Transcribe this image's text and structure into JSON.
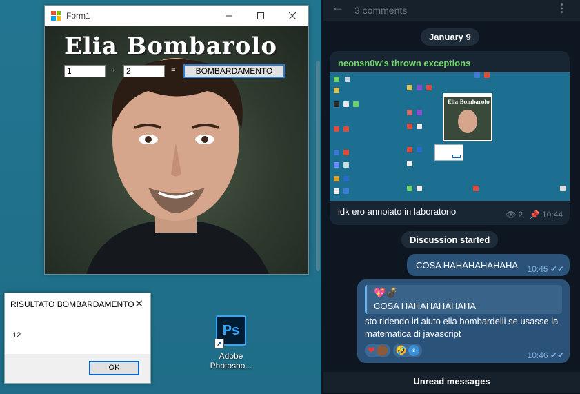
{
  "form1": {
    "title": "Form1",
    "heading": "Elia Bombarolo",
    "input_a": "1",
    "plus_label": "+",
    "input_b": "2",
    "equals_label": "=",
    "button_label": "BOMBARDAMENTO"
  },
  "dialog": {
    "title": "RISULTATO BOMBARDAMENTO",
    "message": "12",
    "ok_label": "OK"
  },
  "desktop_icon": {
    "glyph": "Ps",
    "label_line1": "Adobe",
    "label_line2": "Photosho..."
  },
  "telegram": {
    "header_title": "3 comments",
    "date_pill": "January 9",
    "post": {
      "channel": "neonsn0w's thrown exceptions",
      "embedded_heading": "Elia Bombarolo",
      "caption": "idk ero annoiato in laboratorio",
      "views": "2",
      "time": "10:44"
    },
    "discussion_pill": "Discussion started",
    "msg1": {
      "text": "COSA HAHAHAHAHAHA",
      "time": "10:45"
    },
    "msg2": {
      "reply_emoji": "💖💣",
      "reply_text": "COSA HAHAHAHAHAHA",
      "body": "sto ridendo irl aiuto elia bombardelli se usasse la matematica di javascript",
      "reaction1": "❤",
      "reaction2": "🤣",
      "reaction2_avatar": "s",
      "time": "10:46"
    },
    "unread_label": "Unread messages"
  },
  "colors": {
    "desktop_bg": "#1f6f8b",
    "telegram_bg": "#0e1621",
    "bubble_out": "#2b5278",
    "channel_name": "#71d467",
    "focus_border": "#2a7bd3"
  },
  "icons": {
    "back": "arrow-left-icon",
    "more": "kebab-menu-icon",
    "views": "eye-icon",
    "pinned": "pin-icon",
    "read": "double-check-icon"
  }
}
